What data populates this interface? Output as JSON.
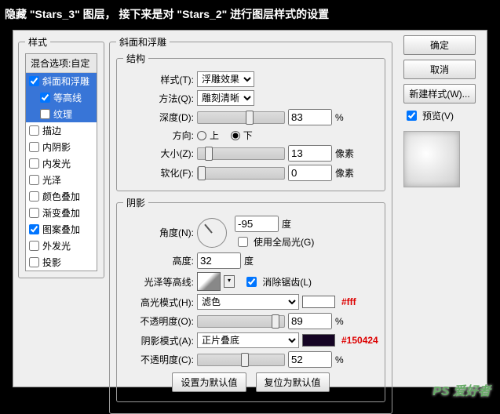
{
  "caption": "隐藏 \"Stars_3\" 图层，  接下来是对  \"Stars_2\"  进行图层样式的设置",
  "left": {
    "title": "样式",
    "blendLabel": "混合选项:自定",
    "items": [
      {
        "label": "斜面和浮雕",
        "checked": true,
        "sel": true
      },
      {
        "label": "等高线",
        "checked": true,
        "sel": true,
        "indent": true
      },
      {
        "label": "纹理",
        "checked": false,
        "sel": true,
        "indent": true
      },
      {
        "label": "描边",
        "checked": false
      },
      {
        "label": "内阴影",
        "checked": false
      },
      {
        "label": "内发光",
        "checked": false
      },
      {
        "label": "光泽",
        "checked": false
      },
      {
        "label": "颜色叠加",
        "checked": false
      },
      {
        "label": "渐变叠加",
        "checked": false
      },
      {
        "label": "图案叠加",
        "checked": true
      },
      {
        "label": "外发光",
        "checked": false
      },
      {
        "label": "投影",
        "checked": false
      }
    ]
  },
  "bevel": {
    "panelTitle": "斜面和浮雕",
    "structTitle": "结构",
    "styleLbl": "样式(T):",
    "styleVal": "浮雕效果",
    "techLbl": "方法(Q):",
    "techVal": "雕刻清晰",
    "depthLbl": "深度(D):",
    "depthVal": "83",
    "pct": "%",
    "dirLbl": "方向:",
    "upLbl": "上",
    "downLbl": "下",
    "sizeLbl": "大小(Z):",
    "sizeVal": "13",
    "px": "像素",
    "softLbl": "软化(F):",
    "softVal": "0",
    "shadeTitle": "阴影",
    "angleLbl": "角度(N):",
    "angleVal": "-95",
    "deg": "度",
    "globalLbl": "使用全局光(G)",
    "altLbl": "高度:",
    "altVal": "32",
    "glossLbl": "光泽等高线:",
    "aaLbl": "消除锯齿(L)",
    "hiLbl": "高光模式(H):",
    "hiVal": "滤色",
    "hiColor": "#ffffff",
    "hiAnnot": "#fff",
    "hiOpLbl": "不透明度(O):",
    "hiOpVal": "89",
    "shLbl": "阴影模式(A):",
    "shVal": "正片叠底",
    "shColor": "#150424",
    "shAnnot": "#150424",
    "shOpLbl": "不透明度(C):",
    "shOpVal": "52",
    "defaultBtn": "设置为默认值",
    "resetBtn": "复位为默认值"
  },
  "right": {
    "ok": "确定",
    "cancel": "取消",
    "newStyle": "新建样式(W)...",
    "previewLbl": "预览(V)"
  },
  "wm": "PS 爱好者"
}
